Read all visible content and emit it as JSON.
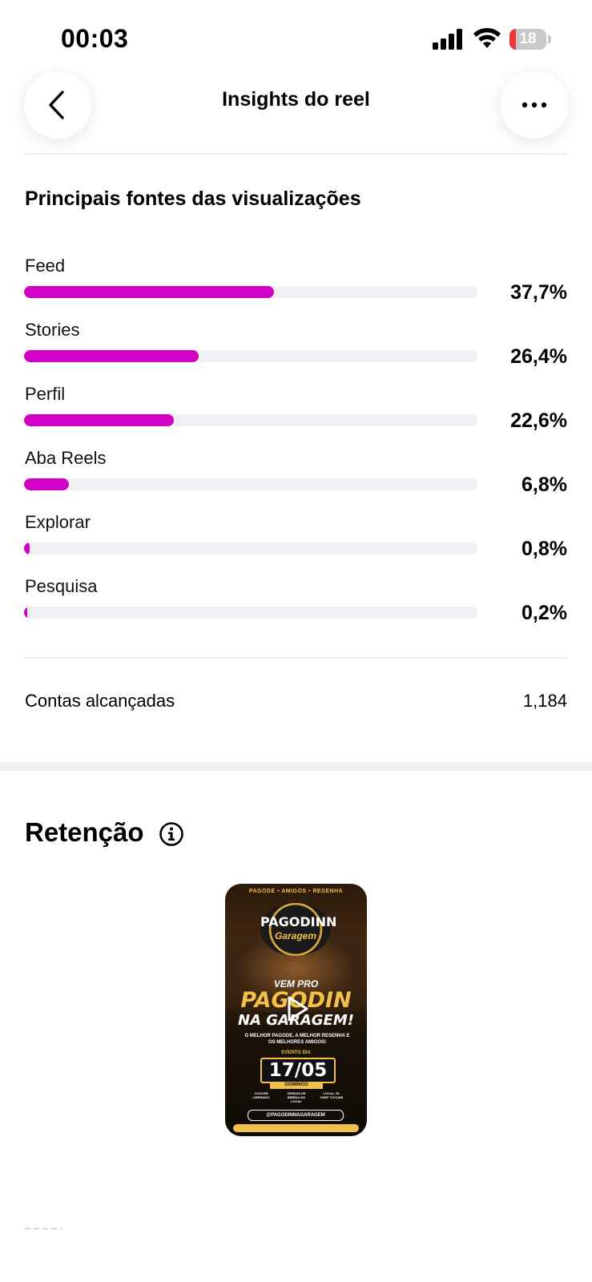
{
  "status_bar": {
    "time": "00:03",
    "battery_level": "18",
    "battery_fraction": 0.18,
    "battery_color": "#eb3b3b"
  },
  "header": {
    "title": "Insights do reel",
    "back_icon": "chevron-left-icon",
    "more_icon": "ellipsis-icon"
  },
  "sources": {
    "title": "Principais fontes das visualizações",
    "bar_color": "#d300c8",
    "items": [
      {
        "label": "Feed",
        "value": "37,7%",
        "fraction": 0.377
      },
      {
        "label": "Stories",
        "value": "26,4%",
        "fraction": 0.264
      },
      {
        "label": "Perfil",
        "value": "22,6%",
        "fraction": 0.226
      },
      {
        "label": "Aba Reels",
        "value": "6,8%",
        "fraction": 0.068
      },
      {
        "label": "Explorar",
        "value": "0,8%",
        "fraction": 0.008
      },
      {
        "label": "Pesquisa",
        "value": "0,2%",
        "fraction": 0.002
      }
    ]
  },
  "reach": {
    "label": "Contas alcançadas",
    "value": "1,184"
  },
  "retention": {
    "title": "Retenção",
    "info_icon": "info-icon"
  },
  "thumbnail": {
    "top_line": "PAGODE • AMIGOS • RESENHA",
    "logo_line1": "PAGODINN",
    "logo_line2": "Garagem",
    "vem_pro": "VEM PRO",
    "headline1": "PAGODIN",
    "headline2": "NA GARAGEM!",
    "subline": "O MELHOR PAGODE, A MELHOR RESENHA E OS MELHORES AMIGOS!",
    "event_label": "EVENTO DIA",
    "date": "17/05",
    "day": "DOMINGO",
    "feature1": "COOLER LIBERADO",
    "feature2": "VENDAS DE BEBIDA NO LOCAL",
    "feature3": "LOCAL: EL CHEF TUCUNS",
    "handle": "@PAGODINNAGARAGEM",
    "play_icon": "play-icon"
  }
}
